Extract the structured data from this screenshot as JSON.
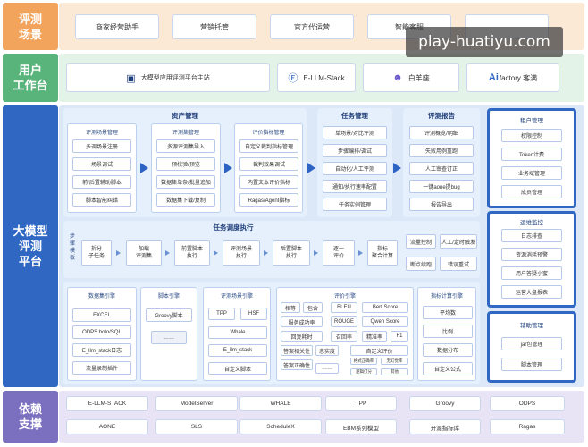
{
  "colors": {
    "label_orange": "#f2a35c",
    "label_green": "#58b47a",
    "label_blue": "#2f67c3",
    "label_purple": "#7b6fc0",
    "band_orange": "#fbe9d6",
    "band_green": "#e3f3e8",
    "band_blue": "#dce8f8",
    "band_purple": "#e8e4f6"
  },
  "sections": {
    "scenarios": "评测\n场景",
    "workbench": "用户\n工作台",
    "platform": "大模型\n评测\n平台",
    "dependencies": "依赖\n支撑"
  },
  "scenarios": [
    "商家经营助手",
    "营销托管",
    "官方代运营",
    "智能客服",
    ""
  ],
  "workbench": [
    {
      "icon": "grid-logo-icon",
      "glyph": "▣",
      "label": "大模型应用评测平台主站"
    },
    {
      "icon": "e-logo-icon",
      "glyph": "Ⓔ",
      "label": "E-LLM-Stack"
    },
    {
      "icon": "people-logo-icon",
      "glyph": "☻",
      "label": "白羊座"
    },
    {
      "icon": "ai-logo-icon",
      "glyph": "Ai",
      "label": "factory 客满"
    }
  ],
  "asset_mgmt": {
    "title": "资产管理",
    "scene": {
      "title": "评测场景管理",
      "items": [
        "多调场景注册",
        "场景调试",
        "前/后置辅助脚本",
        "脚本智能纠错"
      ]
    },
    "dataset": {
      "title": "评测集管理",
      "items": [
        "多源评测集导入",
        "预校验/预览",
        "数据集单条/批量追加",
        "数据集下载/复制"
      ]
    },
    "metric": {
      "title": "评价指标管理",
      "items": [
        "自定义裁判指标管理",
        "裁判效果调试",
        "内置文本评价指标",
        "Ragas/Agent指标"
      ]
    }
  },
  "task_mgmt": {
    "title": "任务管理",
    "items": [
      "单场景/对比评测",
      "步骤编排/调试",
      "自动化/人工评测",
      "通知/执行速率配置",
      "任务实例管理"
    ]
  },
  "report": {
    "title": "评测报告",
    "items": [
      "评测概览/明细",
      "失败用例重跑",
      "人工审查订正",
      "一键aone提bug",
      "报告导出"
    ]
  },
  "tenant": {
    "title": "租户管理",
    "items": [
      "权限控制",
      "Token计费",
      "业务域管理",
      "成员管理"
    ]
  },
  "ops": {
    "title": "运维监控",
    "items": [
      "日志排查",
      "资源消耗预警",
      "用户答疑小蜜",
      "运营大盘报表"
    ]
  },
  "aux": {
    "title": "辅助管理",
    "items": [
      "jar包管理",
      "脚本管理"
    ]
  },
  "scheduler": {
    "title": "任务调度执行",
    "side_label": "步\n骤\n模\n板",
    "steps": [
      "拆分\n子任务",
      "加载\n评测集",
      "前置脚本\n执行",
      "评测场景\n执行",
      "后置脚本\n执行",
      "逐一\n评价",
      "指标\n聚合计算"
    ],
    "extras": [
      "流量控制",
      "人工/定时触发",
      "断点续跑",
      "错误重试"
    ]
  },
  "engines": {
    "data": {
      "title": "数据集引擎",
      "items": [
        "EXCEL",
        "ODPS holo/SQL",
        "E_llm_stack日志",
        "流量录制插件"
      ]
    },
    "script": {
      "title": "脚本引擎",
      "items": [
        "Groovy脚本",
        "……"
      ]
    },
    "scene": {
      "title": "评测场景引擎",
      "items": [
        "TPP",
        "HSF",
        "Whale",
        "E_llm_stack",
        "自定义脚本"
      ]
    },
    "eval": {
      "title": "评价引擎",
      "items": [
        "相等",
        "包含",
        "BLEU",
        "Bert Score",
        "服务成功率",
        "ROUGE",
        "Qwen Score",
        "回复耗时",
        "召回率",
        "精准率",
        "F1",
        "答案相关性",
        "忠实度",
        "自定义评价",
        "答案正确性",
        "……",
        "格式正确率",
        "无幻觉率",
        "逻辑打分",
        "其他"
      ]
    },
    "metric": {
      "title": "指标计算引擎",
      "items": [
        "平均数",
        "比例",
        "数据分布",
        "自定义公式"
      ]
    }
  },
  "deps": [
    "E-LLM-STACK",
    "ModelServer",
    "WHALE",
    "TPP",
    "Groovy",
    "ODPS",
    "AONE",
    "SLS",
    "ScheduleX",
    "EBM系列模型",
    "开源指标库",
    "Ragas"
  ],
  "watermark": "play-huatiyu.com"
}
